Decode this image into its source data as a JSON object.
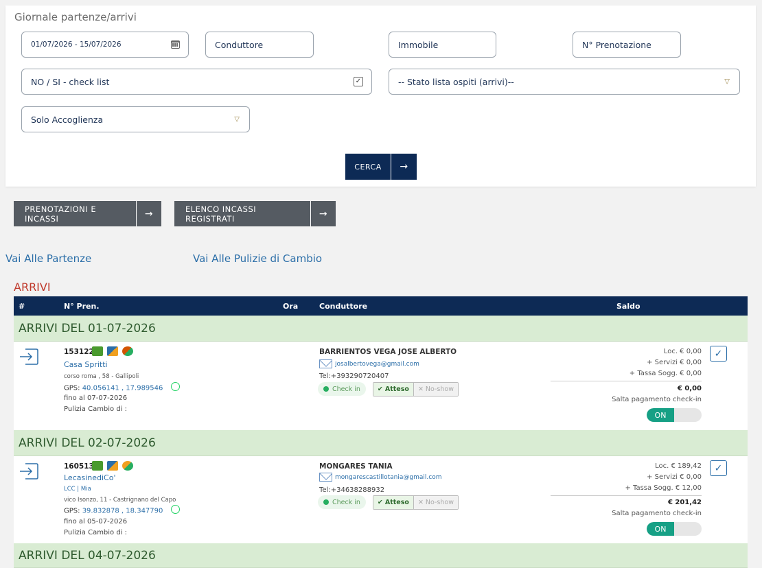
{
  "search": {
    "title": "Giornale partenze/arrivi",
    "date_range": "01/07/2026 - 15/07/2026",
    "conduttore_placeholder": "Conduttore",
    "immobile_placeholder": "Immobile",
    "prenotazione_placeholder": "N° Prenotazione",
    "checklist_select": "NO / SI - check list",
    "stato_select": "-- Stato lista ospiti (arrivi)--",
    "accoglienza_select": "Solo Accoglienza",
    "cerca_label": "CERCA"
  },
  "actions": {
    "prenotazioni_label": "PRENOTAZIONI E INCASSI",
    "incassi_label": "ELENCO INCASSI REGISTRATI"
  },
  "links": {
    "partenze": "Vai Alle Partenze",
    "pulizie": "Vai Alle Pulizie di Cambio"
  },
  "arrivi": {
    "title": "ARRIVI",
    "columns": [
      "#",
      "N° Pren.",
      "Ora",
      "Conduttore",
      "Saldo"
    ],
    "groups": [
      {
        "label": "ARRIVI DEL  01-07-2026",
        "entry": {
          "pren": "153122",
          "property": "Casa Spritti",
          "tag": "",
          "address": "corso roma , 58 - Gallipoli",
          "gps_label": "GPS:",
          "gps": "40.056141 , 17.989546",
          "fino": "fino al 07-07-2026",
          "pulizia": "Pulizia Cambio di :",
          "guest": "BARRIENTOS VEGA JOSE ALBERTO",
          "email": "josalbertovega@gmail.com",
          "tel": "Tel:+393290720407",
          "checkin": "Check in",
          "atteso": "Atteso",
          "noshow": "No-show",
          "loc": "Loc. € 0,00",
          "servizi": "+ Servizi € 0,00",
          "tassa": "+ Tassa Sogg. € 0,00",
          "totale": "€ 0,00",
          "salta": "Salta pagamento check-in",
          "toggle": "ON"
        }
      },
      {
        "label": "ARRIVI DEL  02-07-2026",
        "entry": {
          "pren": "160513",
          "property": "LecasinediCo'",
          "tag": "LCC | Mia",
          "address": "vico Isonzo, 11 - Castrignano del Capo",
          "gps_label": "GPS:",
          "gps": "39.832878 , 18.347790",
          "fino": "fino al 05-07-2026",
          "pulizia": "Pulizia Cambio di :",
          "guest": "MONGARES TANIA",
          "email": "mongarescastillotania@gmail.com",
          "tel": "Tel:+34638288932",
          "checkin": "Check in",
          "atteso": "Atteso",
          "noshow": "No-show",
          "loc": "Loc. € 189,42",
          "servizi": "+ Servizi € 0,00",
          "tassa": "+ Tassa Sogg. € 12,00",
          "totale": "€ 201,42",
          "salta": "Salta pagamento check-in",
          "toggle": "ON"
        }
      },
      {
        "label": "ARRIVI DEL  04-07-2026"
      }
    ]
  },
  "colors": {
    "navy": "#0d2a55",
    "group_bg": "#d9ecd3",
    "arrivi_red": "#c0392b",
    "toggle_on": "#16a085",
    "link_blue": "#2b6ea8"
  }
}
